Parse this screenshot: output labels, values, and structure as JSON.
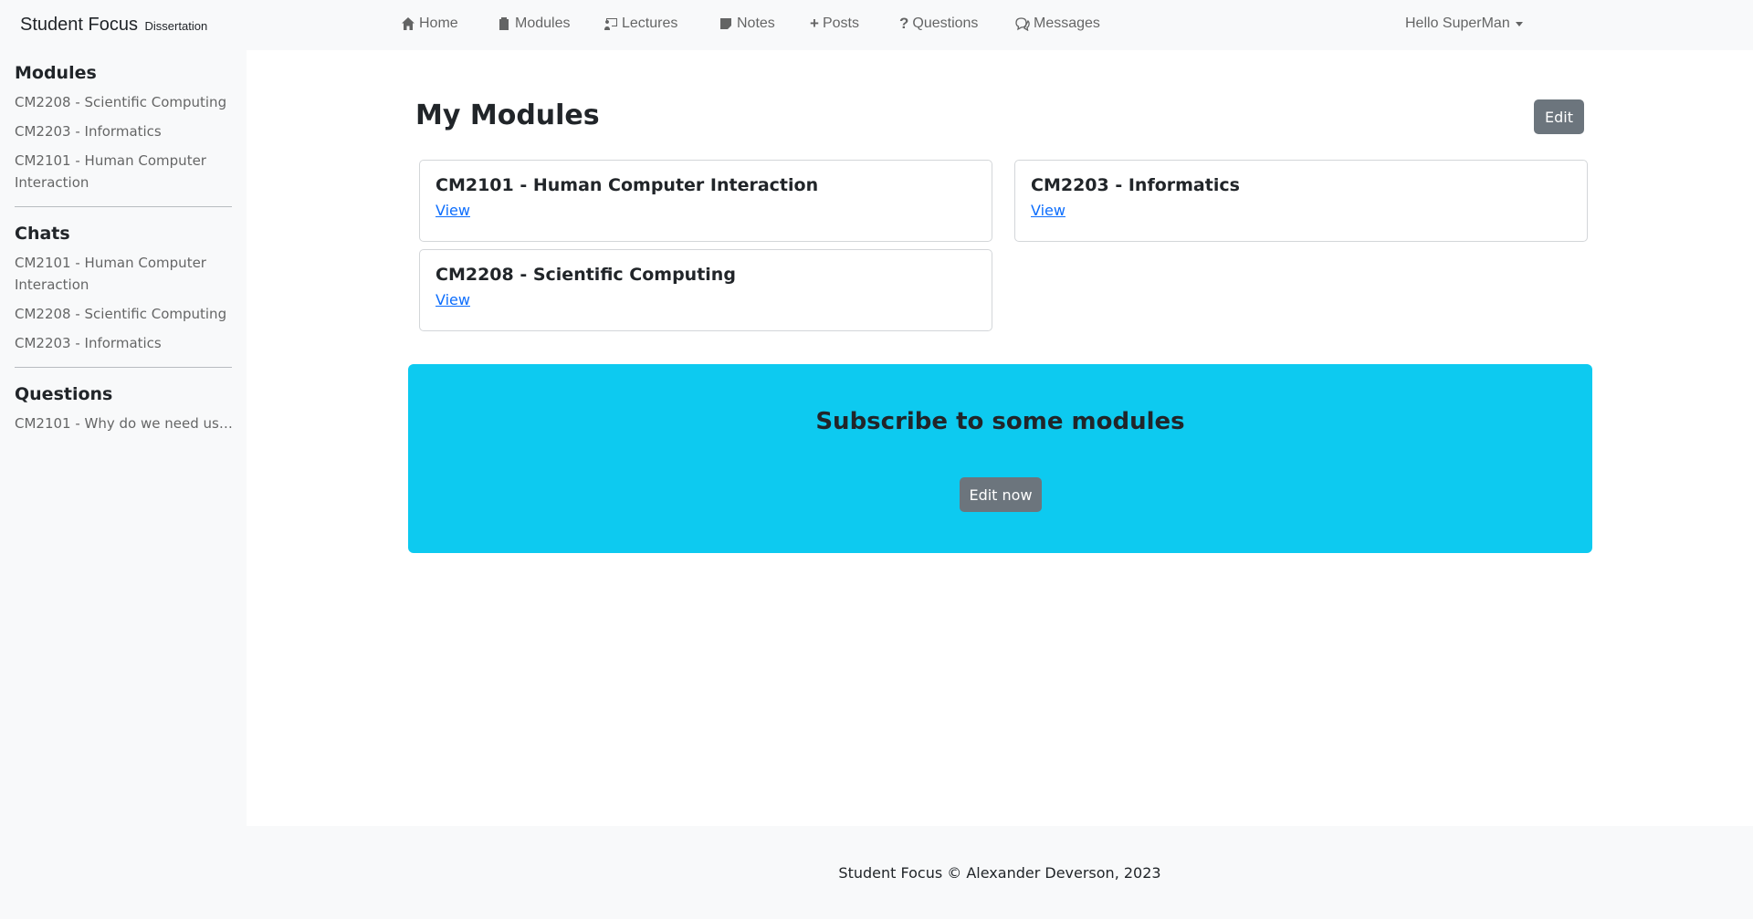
{
  "brand": {
    "name": "Student Focus",
    "tagline": "Dissertation"
  },
  "nav": {
    "items": [
      {
        "label": "Home",
        "icon": "house-icon"
      },
      {
        "label": "Modules",
        "icon": "clipboard-icon"
      },
      {
        "label": "Lectures",
        "icon": "person-video-icon"
      },
      {
        "label": "Notes",
        "icon": "sticky-note-icon"
      },
      {
        "label": "Posts",
        "icon": "plus-icon"
      },
      {
        "label": "Questions",
        "icon": "question-icon"
      },
      {
        "label": "Messages",
        "icon": "chat-dots-icon"
      }
    ],
    "user_menu": "Hello SuperMan"
  },
  "sidebar": {
    "modules_heading": "Modules",
    "modules": [
      "CM2208 - Scientific Computing",
      "CM2203 - Informatics",
      "CM2101 - Human Computer Interaction"
    ],
    "chats_heading": "Chats",
    "chats": [
      "CM2101 - Human Computer Interaction",
      "CM2208 - Scientific Computing",
      "CM2203 - Informatics"
    ],
    "questions_heading": "Questions",
    "questions": [
      "CM2101 - Why do we need use..."
    ]
  },
  "main": {
    "title": "My Modules",
    "edit_label": "Edit",
    "cards": [
      {
        "title": "CM2101 - Human Computer Interaction",
        "link": "View"
      },
      {
        "title": "CM2203 - Informatics",
        "link": "View"
      },
      {
        "title": "CM2208 - Scientific Computing",
        "link": "View"
      }
    ],
    "banner": {
      "heading": "Subscribe to some modules",
      "button": "Edit now"
    }
  },
  "footer": {
    "text": "Student Focus © Alexander Deverson, 2023"
  },
  "colors": {
    "banner": "#0dcaf0",
    "link": "#0d6efd",
    "button": "#6c757d"
  }
}
